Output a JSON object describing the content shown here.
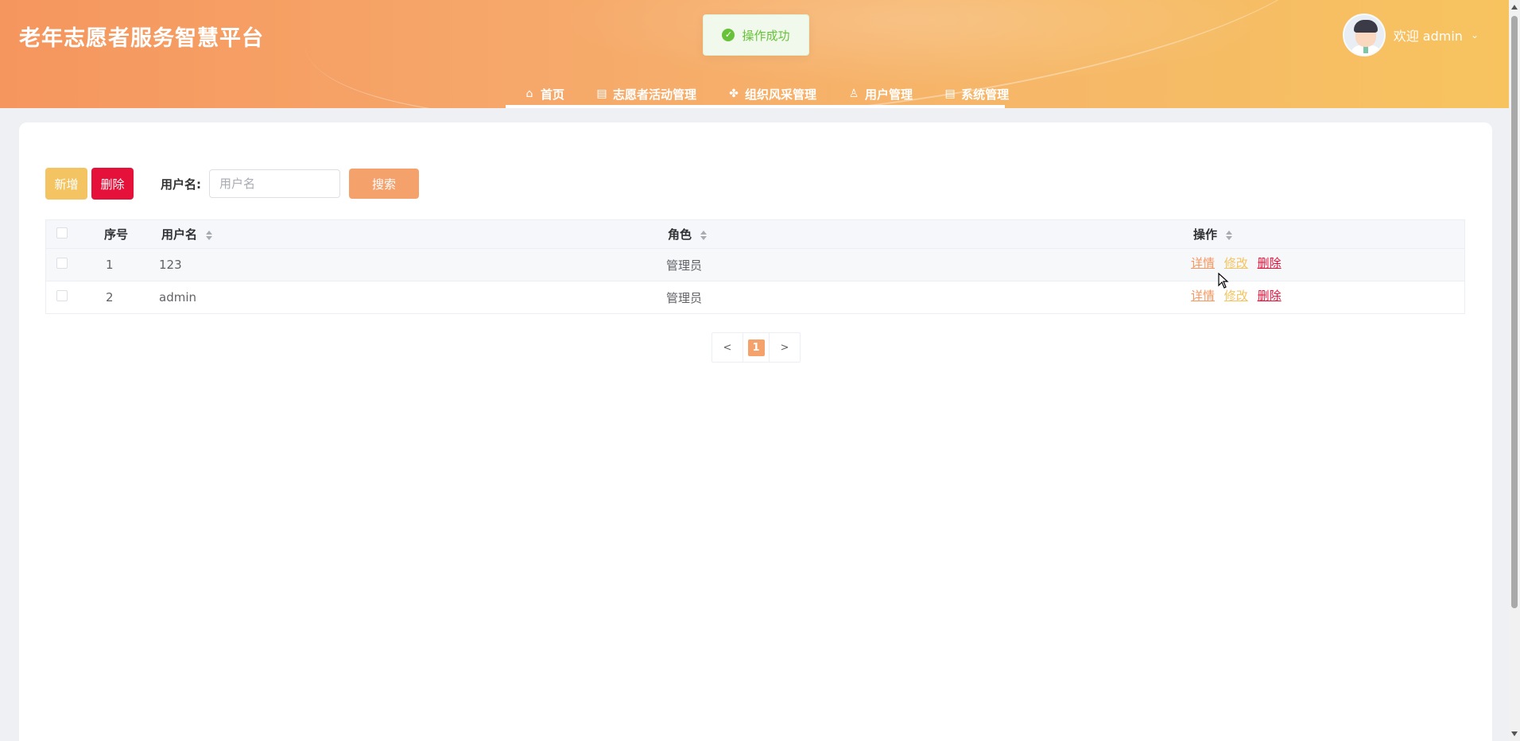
{
  "header": {
    "title": "老年志愿者服务智慧平台",
    "welcome": "欢迎 admin",
    "nav": [
      {
        "label": "首页",
        "icon": "home-icon"
      },
      {
        "label": "志愿者活动管理",
        "icon": "table-icon"
      },
      {
        "label": "组织风采管理",
        "icon": "grid-icon"
      },
      {
        "label": "用户管理",
        "icon": "user-icon"
      },
      {
        "label": "系统管理",
        "icon": "table-icon"
      }
    ]
  },
  "toast": {
    "text": "操作成功",
    "type": "success"
  },
  "toolbar": {
    "add_label": "新增",
    "delete_label": "删除",
    "search_label": "用户名:",
    "search_placeholder": "用户名",
    "search_value": "",
    "search_button": "搜索"
  },
  "table": {
    "headers": [
      "序号",
      "用户名",
      "角色",
      "操作"
    ],
    "rows": [
      {
        "index": "1",
        "username": "123",
        "role": "管理员"
      },
      {
        "index": "2",
        "username": "admin",
        "role": "管理员"
      }
    ],
    "actions": {
      "detail": "详情",
      "edit": "修改",
      "delete": "删除"
    }
  },
  "pagination": {
    "prev": "<",
    "current": "1",
    "next": ">"
  },
  "colors": {
    "accent": "#f5a16c",
    "add": "#f3c461",
    "danger": "#e6113a",
    "success": "#67c23a"
  }
}
